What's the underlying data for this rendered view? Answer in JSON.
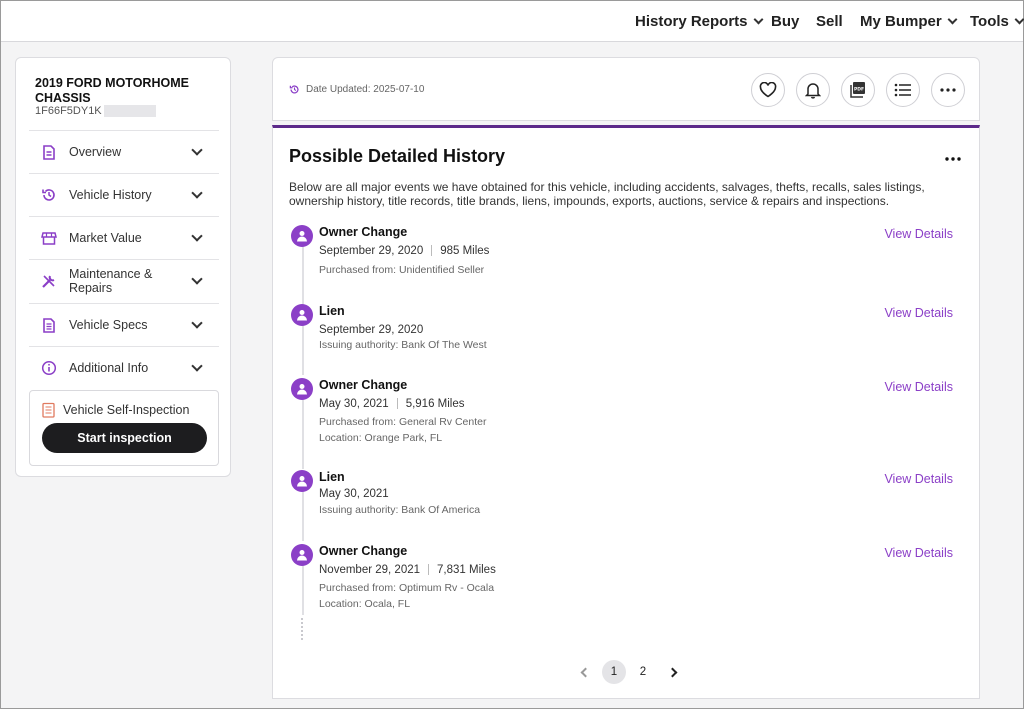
{
  "topnav": {
    "items": [
      {
        "label": "History Reports",
        "dropdown": true
      },
      {
        "label": "Buy",
        "dropdown": false
      },
      {
        "label": "Sell",
        "dropdown": false
      },
      {
        "label": "My Bumper",
        "dropdown": true
      },
      {
        "label": "Tools",
        "dropdown": true
      }
    ]
  },
  "sidebar": {
    "vehicle_title": "2019 FORD MOTORHOME CHASSIS",
    "vin_partial": "1F66F5DY1K",
    "items": [
      {
        "label": "Overview",
        "icon": "document-icon"
      },
      {
        "label": "Vehicle History",
        "icon": "history-icon"
      },
      {
        "label": "Market Value",
        "icon": "store-icon"
      },
      {
        "label": "Maintenance & Repairs",
        "icon": "tools-icon"
      },
      {
        "label": "Vehicle Specs",
        "icon": "spec-sheet-icon"
      },
      {
        "label": "Additional Info",
        "icon": "info-icon"
      }
    ],
    "inspection": {
      "label": "Vehicle Self-Inspection",
      "button": "Start inspection"
    }
  },
  "header": {
    "date_updated": "Date Updated: 2025-07-10",
    "actions": [
      "heart-icon",
      "bell-icon",
      "pdf-icon",
      "list-icon",
      "more-icon"
    ]
  },
  "history": {
    "title": "Possible Detailed History",
    "description": "Below are all major events we have obtained for this vehicle, including accidents, salvages, thefts, recalls, sales listings, ownership history, title records, title brands, liens, impounds, exports, auctions, service & repairs and inspections.",
    "view_label": "View Details",
    "events": [
      {
        "title": "Owner Change",
        "date": "September 29, 2020",
        "miles": "985 Miles",
        "sub1": "Purchased from: Unidentified Seller",
        "sub2": ""
      },
      {
        "title": "Lien",
        "date": "September 29, 2020",
        "miles": "",
        "sub1": "Issuing authority: Bank Of The West",
        "sub2": ""
      },
      {
        "title": "Owner Change",
        "date": "May 30, 2021",
        "miles": "5,916 Miles",
        "sub1": "Purchased from: General Rv Center",
        "sub2": "Location: Orange Park, FL"
      },
      {
        "title": "Lien",
        "date": "May 30, 2021",
        "miles": "",
        "sub1": "Issuing authority: Bank Of America",
        "sub2": ""
      },
      {
        "title": "Owner Change",
        "date": "November 29, 2021",
        "miles": "7,831 Miles",
        "sub1": "Purchased from: Optimum Rv - Ocala",
        "sub2": "Location: Ocala, FL"
      }
    ],
    "pagination": {
      "pages": [
        "1",
        "2"
      ],
      "current": "1"
    }
  },
  "colors": {
    "accent": "#8b3fc7",
    "header_rule": "#5c2a8a",
    "button_dark": "#1d1d1f"
  }
}
